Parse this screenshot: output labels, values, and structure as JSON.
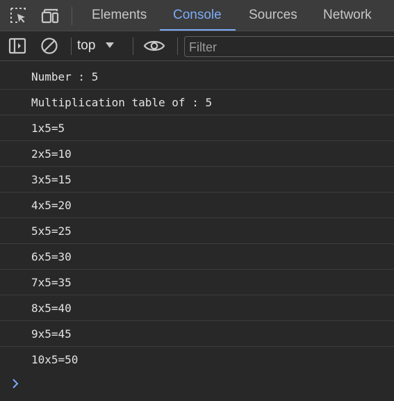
{
  "tabbar": {
    "icons": [
      "inspect-element-icon",
      "device-toolbar-icon"
    ],
    "tabs": [
      {
        "label": "Elements",
        "active": false
      },
      {
        "label": "Console",
        "active": true
      },
      {
        "label": "Sources",
        "active": false
      },
      {
        "label": "Network",
        "active": false
      }
    ]
  },
  "toolbar": {
    "icons": [
      "sidebar-toggle-icon",
      "clear-console-icon",
      "eye-icon"
    ],
    "context": "top",
    "filter_placeholder": "Filter",
    "filter_value": ""
  },
  "console": {
    "messages": [
      "Number : 5",
      "Multiplication table of : 5",
      "1x5=5",
      "2x5=10",
      "3x5=15",
      "4x5=20",
      "5x5=25",
      "6x5=30",
      "7x5=35",
      "8x5=40",
      "9x5=45",
      "10x5=50"
    ],
    "prompt_icon": "chevron-right-icon"
  },
  "colors": {
    "background": "#282828",
    "tabbar_background": "#3c3c3c",
    "accent": "#7cacf8",
    "text": "#e3e3e3"
  }
}
